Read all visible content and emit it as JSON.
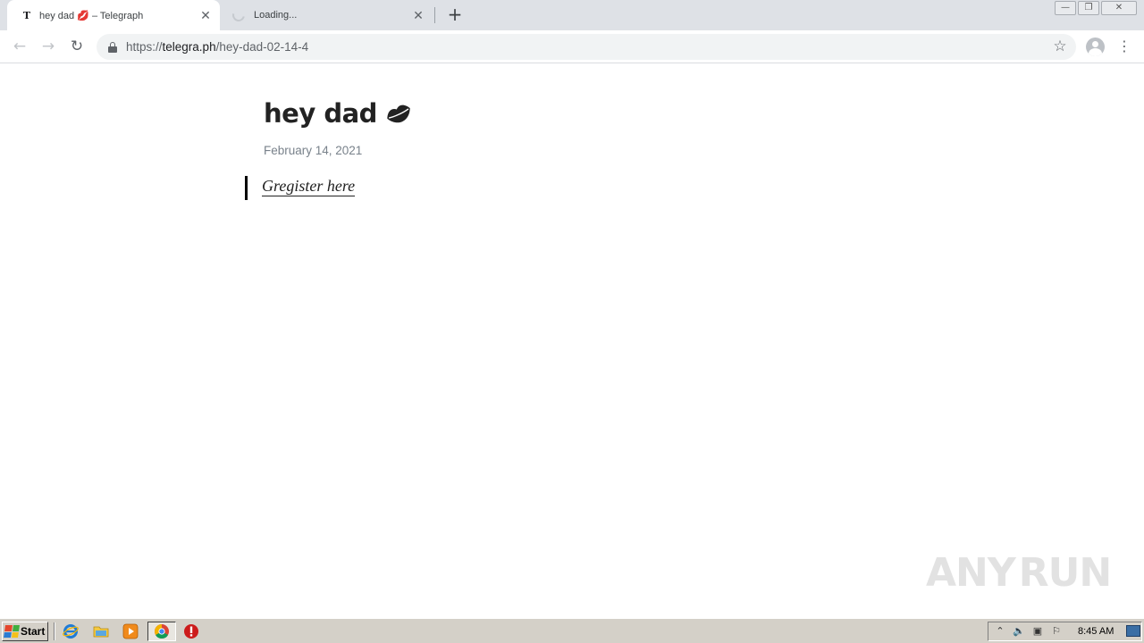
{
  "browser": {
    "tabs": [
      {
        "title": "hey dad 💋 – Telegraph",
        "favicon": "T",
        "active": true
      },
      {
        "title": "Loading...",
        "active": false
      }
    ],
    "new_tab_label": "+",
    "close_glyph": "✕",
    "address": {
      "scheme": "https://",
      "host": "telegra.ph",
      "path": "/hey-dad-02-14-4"
    }
  },
  "page": {
    "title": "hey dad",
    "title_emoji": "lips-icon",
    "date": "February 14, 2021",
    "link_text": "Gregister here"
  },
  "watermark": {
    "left": "ANY",
    "right": "RUN"
  },
  "taskbar": {
    "start_label": "Start",
    "clock": "8:45 AM"
  },
  "colors": {
    "tabstrip": "#dee1e6",
    "title_text": "#222222",
    "date_text": "#79828b",
    "taskbar": "#d4d0c8"
  }
}
